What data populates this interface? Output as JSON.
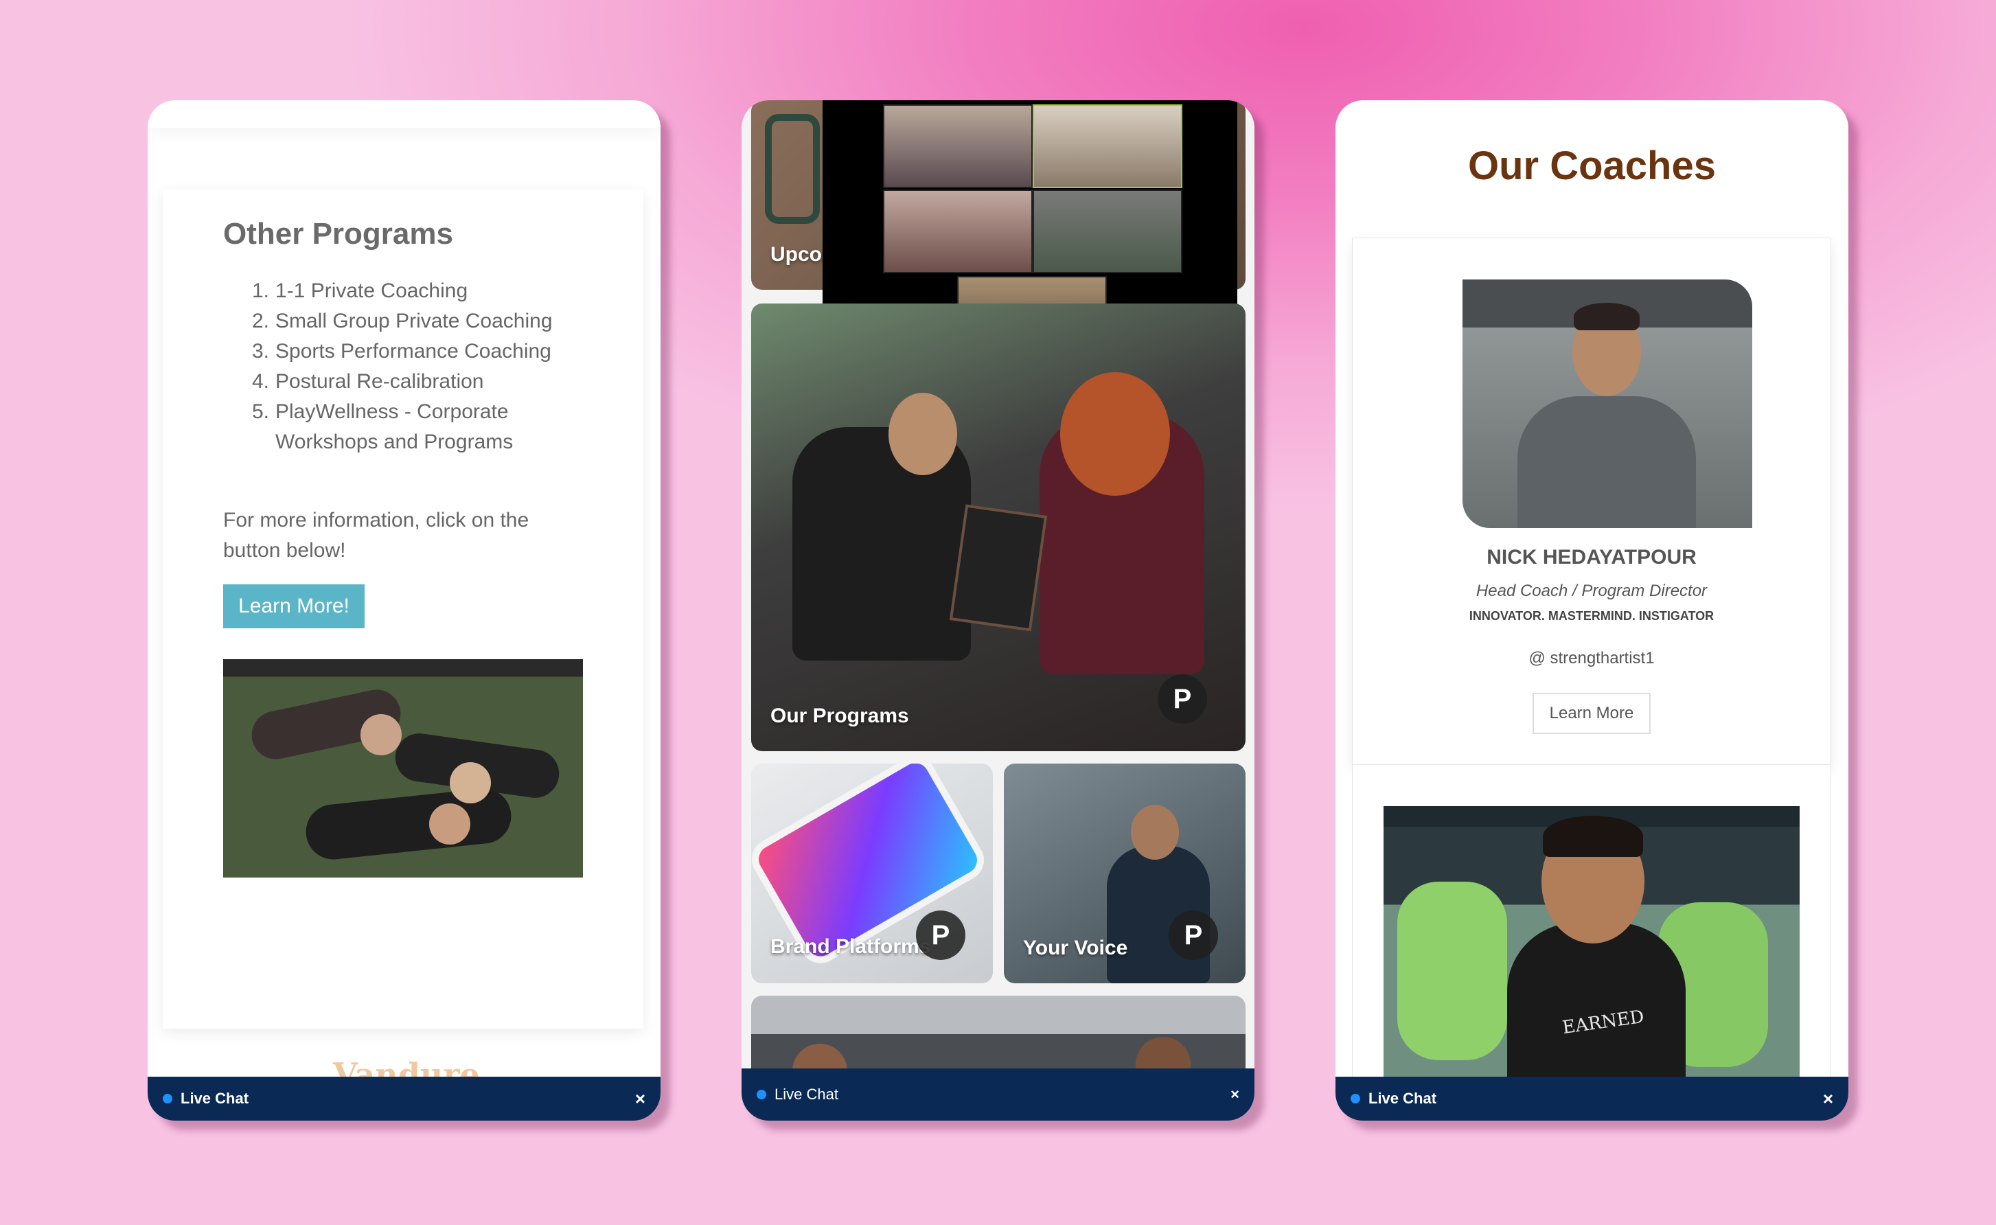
{
  "left_phone": {
    "heading": "Other Programs",
    "programs": [
      {
        "num": "1.",
        "label": "1-1 Private Coaching"
      },
      {
        "num": "2.",
        "label": "Small Group Private Coaching"
      },
      {
        "num": "3.",
        "label": "Sports Performance Coaching"
      },
      {
        "num": "4.",
        "label": "Postural Re-calibration"
      },
      {
        "num": "5.",
        "label": "PlayWellness - Corporate Workshops and Programs"
      }
    ],
    "info_text": "For more information, click on the button below!",
    "button_label": "Learn More!",
    "footer_logo": "Vandure",
    "chat": {
      "label": "Live Chat",
      "close": "×"
    }
  },
  "middle_phone": {
    "tiles": {
      "upcoming": "Upcoi",
      "our_programs": "Our Programs",
      "brand_platforms": "Brand Platforms",
      "your_voice": "Your Voice",
      "badge_glyph": "P"
    },
    "chat": {
      "label": "Live Chat",
      "close": "×"
    }
  },
  "right_phone": {
    "heading": "Our Coaches",
    "coach": {
      "name": "NICK HEDAYATPOUR",
      "role": "Head Coach / Program Director",
      "tagline": "INNOVATOR. MASTERMIND. INSTIGATOR",
      "handle": "@ strengthartist1",
      "button_label": "Learn More"
    },
    "shirt_text": "EARNED",
    "chat": {
      "label": "Live Chat",
      "close": "×"
    }
  },
  "colors": {
    "chat_bar": "#0a2a55",
    "learn_more_teal": "#5bb5c8",
    "coaches_heading": "#6b3410"
  }
}
